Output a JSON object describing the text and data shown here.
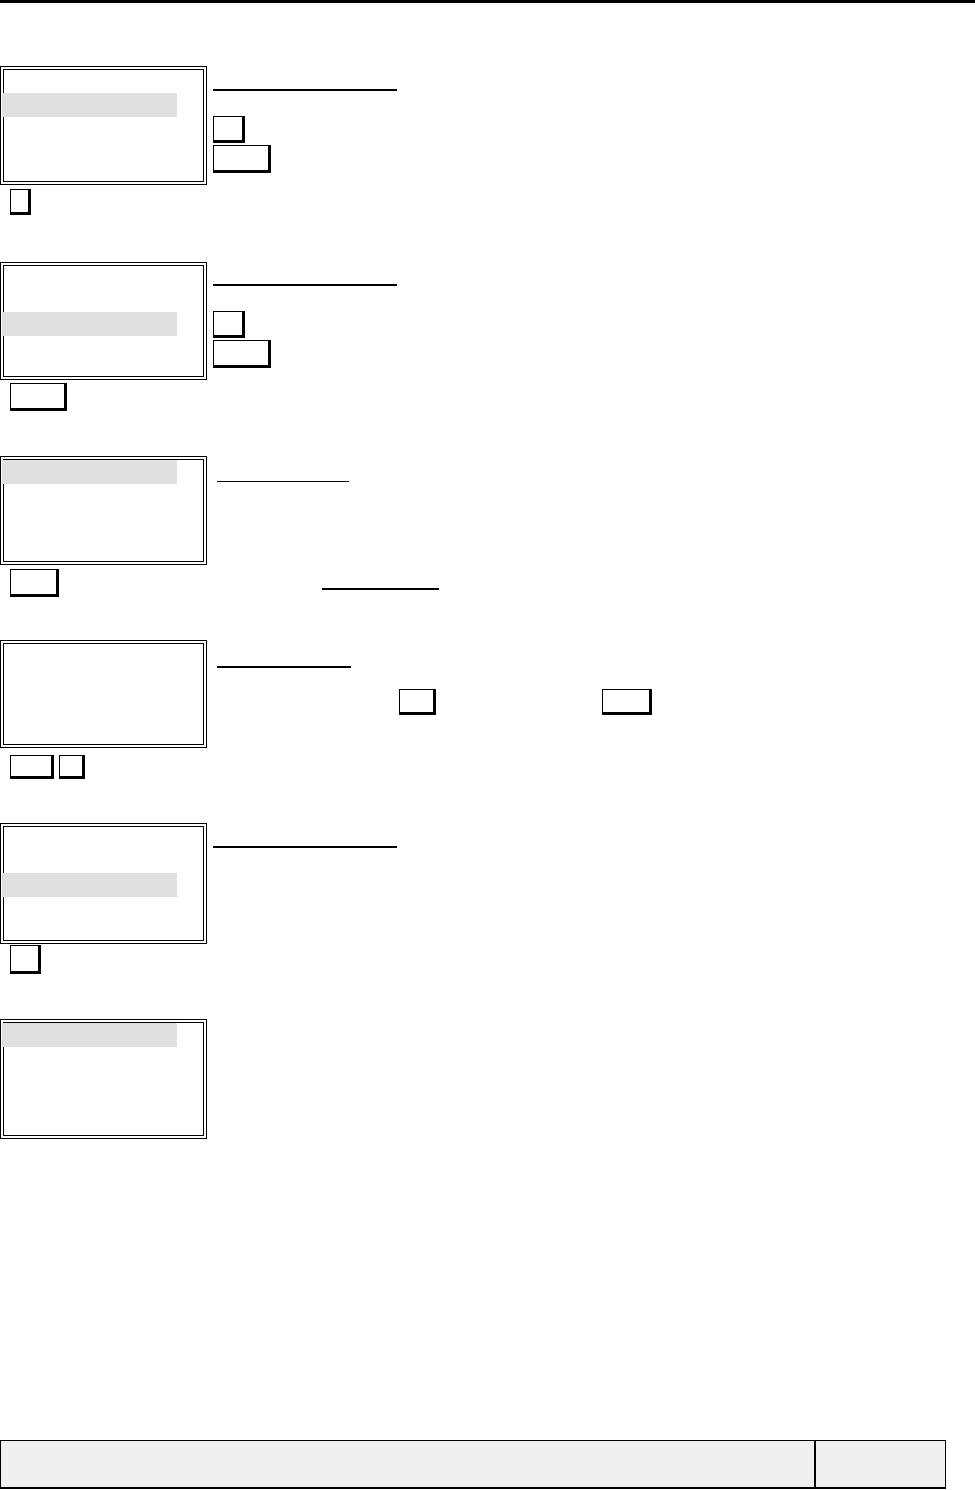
{
  "sections": [
    {
      "list_rows": [
        {
          "selected": false
        },
        {
          "selected": true
        },
        {
          "selected": false
        },
        {
          "selected": false
        },
        {
          "selected": false
        }
      ]
    },
    {
      "list_rows": [
        {
          "selected": false
        },
        {
          "selected": false
        },
        {
          "selected": true
        },
        {
          "selected": false
        },
        {
          "selected": false
        }
      ]
    },
    {
      "list_rows": [
        {
          "selected": true
        },
        {
          "selected": false
        },
        {
          "selected": false
        },
        {
          "selected": false
        }
      ]
    },
    {
      "list_rows": [
        {
          "selected": false
        },
        {
          "selected": false
        },
        {
          "selected": false
        },
        {
          "selected": false
        }
      ]
    },
    {
      "list_rows": [
        {
          "selected": false
        },
        {
          "selected": false
        },
        {
          "selected": true
        },
        {
          "selected": false
        },
        {
          "selected": false
        }
      ]
    },
    {
      "list_rows": [
        {
          "selected": true
        },
        {
          "selected": false
        },
        {
          "selected": false
        },
        {
          "selected": false
        },
        {
          "selected": false
        }
      ]
    }
  ]
}
